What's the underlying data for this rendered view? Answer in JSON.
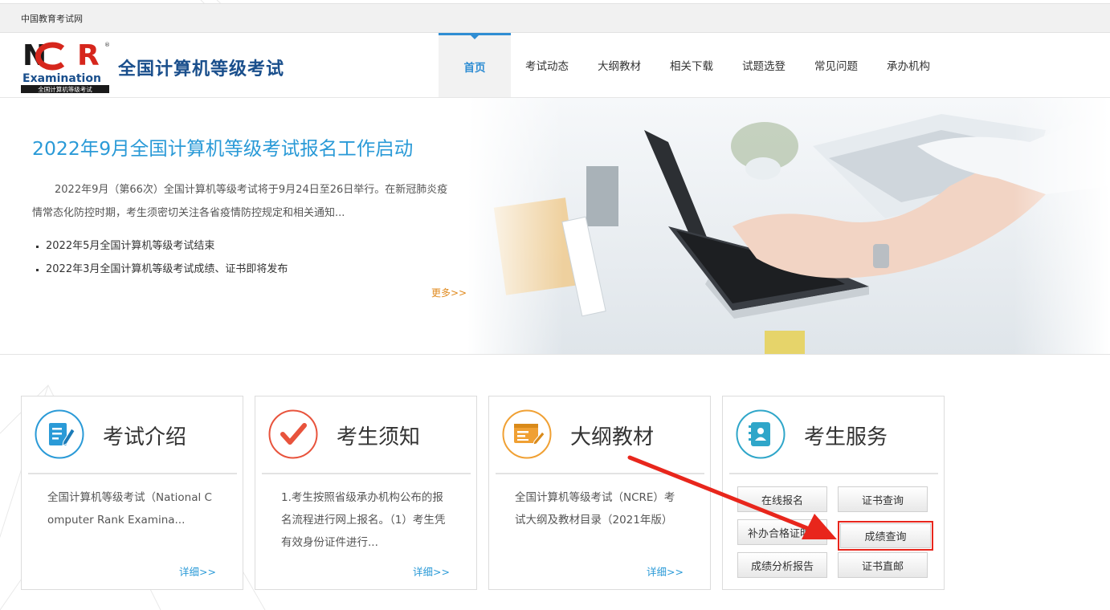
{
  "topbar": {
    "site_name": "中国教育考试网"
  },
  "header": {
    "logo_text_top": "NCR",
    "logo_text_mid": "Examination",
    "logo_text_bottom": "全国计算机等级考试",
    "logo_registered": "®",
    "title": "全国计算机等级考试"
  },
  "nav": {
    "items": [
      {
        "label": "首页",
        "active": true
      },
      {
        "label": "考试动态"
      },
      {
        "label": "大纲教材"
      },
      {
        "label": "相关下载"
      },
      {
        "label": "试题选登"
      },
      {
        "label": "常见问题"
      },
      {
        "label": "承办机构"
      }
    ]
  },
  "banner": {
    "headline": "2022年9月全国计算机等级考试报名工作启动",
    "description": "2022年9月（第66次）全国计算机等级考试将于9月24日至26日举行。在新冠肺炎疫情常态化防控时期，考生须密切关注各省疫情防控规定和相关通知...",
    "news": [
      "2022年5月全国计算机等级考试结束",
      "2022年3月全国计算机等级考试成绩、证书即将发布"
    ],
    "more_label": "更多>>"
  },
  "cards": [
    {
      "title": "考试介绍",
      "icon": "document-edit-icon",
      "text": "全国计算机等级考试（National Computer Rank Examina...",
      "more_label": "详细>>"
    },
    {
      "title": "考生须知",
      "icon": "checkmark-icon",
      "text": "1.考生按照省级承办机构公布的报名流程进行网上报名。（1）考生凭有效身份证件进行...",
      "more_label": "详细>>"
    },
    {
      "title": "大纲教材",
      "icon": "browser-window-icon",
      "text": "全国计算机等级考试（NCRE）考试大纲及教材目录（2021年版）",
      "more_label": "详细>>"
    },
    {
      "title": "考生服务",
      "icon": "contact-book-icon"
    }
  ],
  "services": [
    {
      "label": "在线报名"
    },
    {
      "label": "证书查询"
    },
    {
      "label": "补办合格证明"
    },
    {
      "label": "成绩查询",
      "highlighted": true
    },
    {
      "label": "成绩分析报告"
    },
    {
      "label": "证书直邮"
    }
  ],
  "annotation": {
    "arrow_color": "#e8261c",
    "highlight_target": "成绩查询"
  },
  "colors": {
    "accent_blue": "#2a9ad7",
    "title_navy": "#1a4f8c",
    "logo_red": "#d6261c",
    "more_orange": "#e08a1e",
    "card2_red": "#e8533c",
    "card3_orange": "#f0a033",
    "card4_teal": "#2fa6c9"
  }
}
